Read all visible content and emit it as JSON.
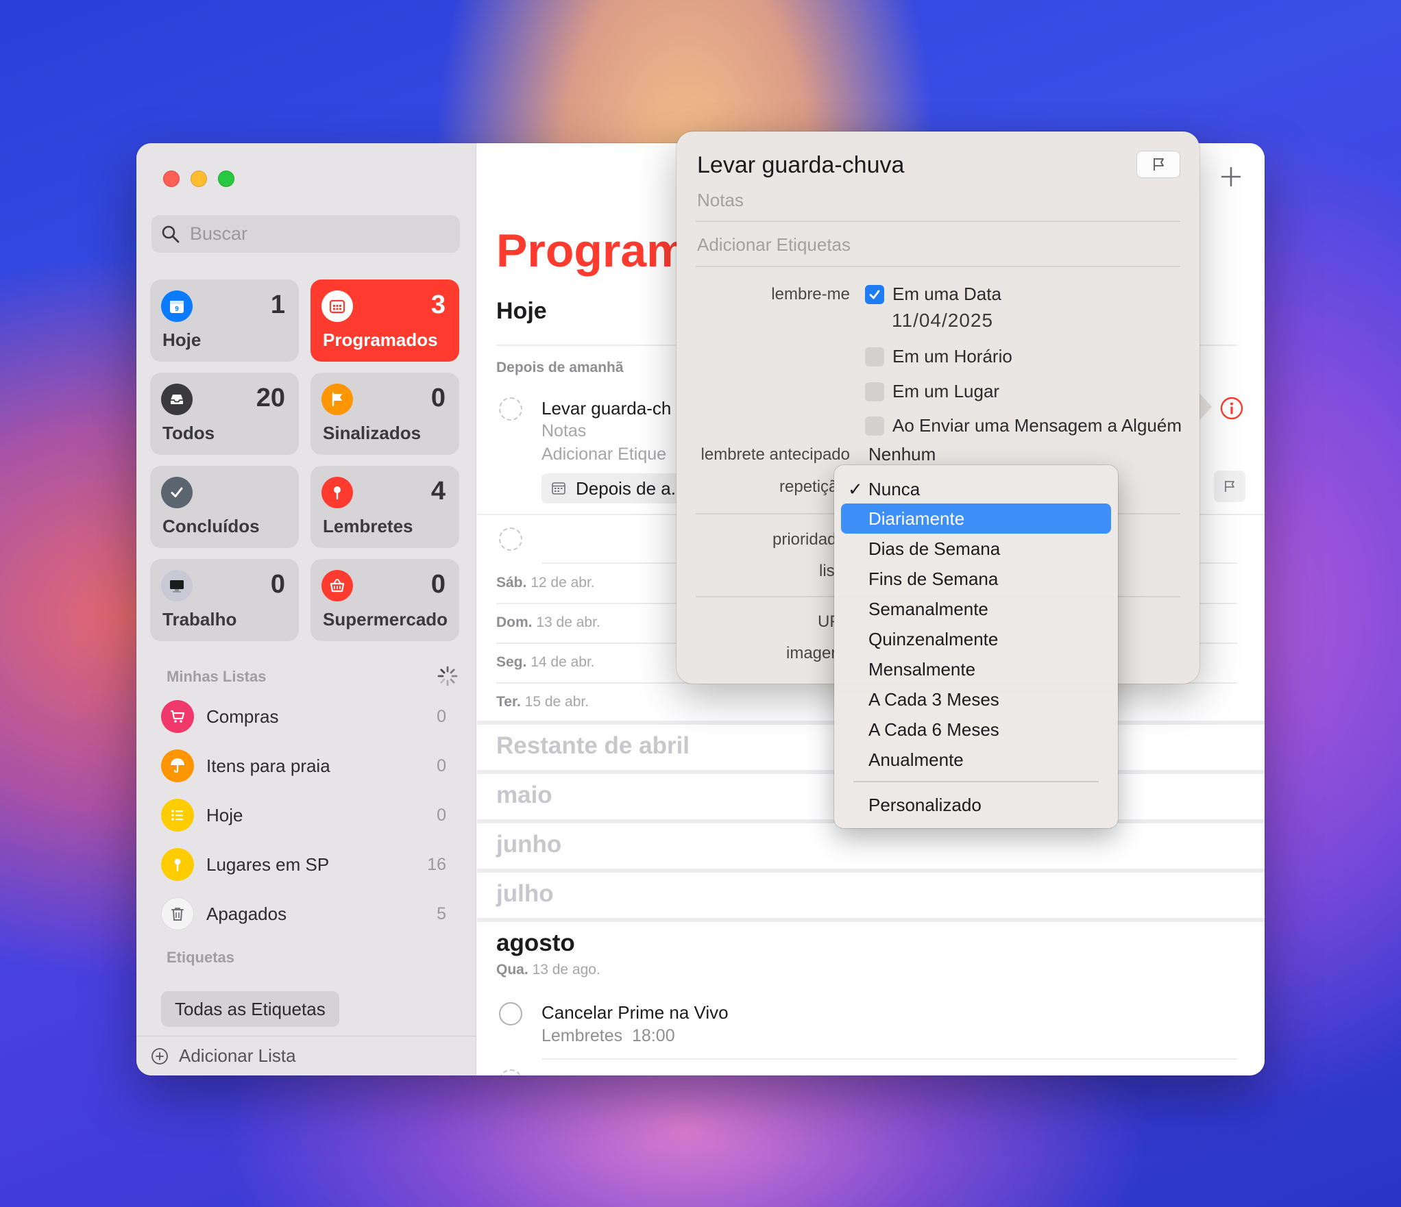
{
  "sidebar": {
    "search_placeholder": "Buscar",
    "tiles": [
      {
        "label": "Hoje",
        "count": "1",
        "icon": "calendar-today-icon",
        "color": "#0a7bff"
      },
      {
        "label": "Programados",
        "count": "3",
        "icon": "calendar-grid-icon",
        "color": "#ff3b30"
      },
      {
        "label": "Todos",
        "count": "20",
        "icon": "tray-icon",
        "color": "#3a3a3c"
      },
      {
        "label": "Sinalizados",
        "count": "0",
        "icon": "flag-icon",
        "color": "#ff9500"
      },
      {
        "label": "Concluídos",
        "count": "",
        "icon": "checkmark-icon",
        "color": "#5b6570"
      },
      {
        "label": "Lembretes",
        "count": "4",
        "icon": "pin-icon",
        "color": "#ff3b30"
      },
      {
        "label": "Trabalho",
        "count": "0",
        "icon": "desktop-icon",
        "color": "#c9c9d6"
      },
      {
        "label": "Supermercado",
        "count": "0",
        "icon": "basket-icon",
        "color": "#ff3b30"
      }
    ],
    "my_lists_label": "Minhas Listas",
    "lists": [
      {
        "name": "Compras",
        "count": "0",
        "icon": "cart-icon",
        "color": "#f0386b"
      },
      {
        "name": "Itens para praia",
        "count": "0",
        "icon": "umbrella-icon",
        "color": "#ff9500"
      },
      {
        "name": "Hoje",
        "count": "0",
        "icon": "list-icon",
        "color": "#ffcc00"
      },
      {
        "name": "Lugares em SP",
        "count": "16",
        "icon": "pin-icon",
        "color": "#ffcc00"
      },
      {
        "name": "Apagados",
        "count": "5",
        "icon": "trash-icon",
        "color": "#f0f0f0"
      }
    ],
    "tags_label": "Etiquetas",
    "all_tags": "Todas as Etiquetas",
    "add_list": "Adicionar Lista"
  },
  "main": {
    "title": "Program",
    "today_header": "Hoje",
    "after_tomorrow": "Depois de amanhã",
    "reminder1": {
      "title": "Levar guarda-ch",
      "notes": "Notas",
      "tags": "Adicionar Etique",
      "date_chip": "Depois de a..."
    },
    "days": [
      {
        "weekday": "Sáb.",
        "date": "12 de abr."
      },
      {
        "weekday": "Dom.",
        "date": "13 de abr."
      },
      {
        "weekday": "Seg.",
        "date": "14 de abr."
      },
      {
        "weekday": "Ter.",
        "date": "15 de abr."
      }
    ],
    "months": [
      "Restante de abril",
      "maio",
      "junho",
      "julho"
    ],
    "august": {
      "header": "agosto",
      "weekday": "Qua.",
      "date": "13 de ago.",
      "reminder": {
        "title": "Cancelar Prime na Vivo",
        "list": "Lembretes",
        "time": "18:00"
      }
    }
  },
  "popover": {
    "title": "Levar guarda-chuva",
    "notes_placeholder": "Notas",
    "tags_placeholder": "Adicionar Etiquetas",
    "remind_label": "lembre-me",
    "on_date": "Em uma Data",
    "date_value": "11/04/2025",
    "at_time": "Em um Horário",
    "at_location": "Em um Lugar",
    "when_messaging": "Ao Enviar uma Mensagem a Alguém",
    "early_label": "lembrete antecipado",
    "early_value": "Nenhum",
    "repeat_label": "repetiçã",
    "priority_label": "prioridad",
    "list_label": "lis",
    "url_label": "UF",
    "image_label": "imager"
  },
  "repeat_menu": {
    "items": [
      "Nunca",
      "Diariamente",
      "Dias de Semana",
      "Fins de Semana",
      "Semanalmente",
      "Quinzenalmente",
      "Mensalmente",
      "A Cada 3 Meses",
      "A Cada 6 Meses",
      "Anualmente"
    ],
    "custom": "Personalizado",
    "checked": "Nunca",
    "highlighted": "Diariamente"
  }
}
